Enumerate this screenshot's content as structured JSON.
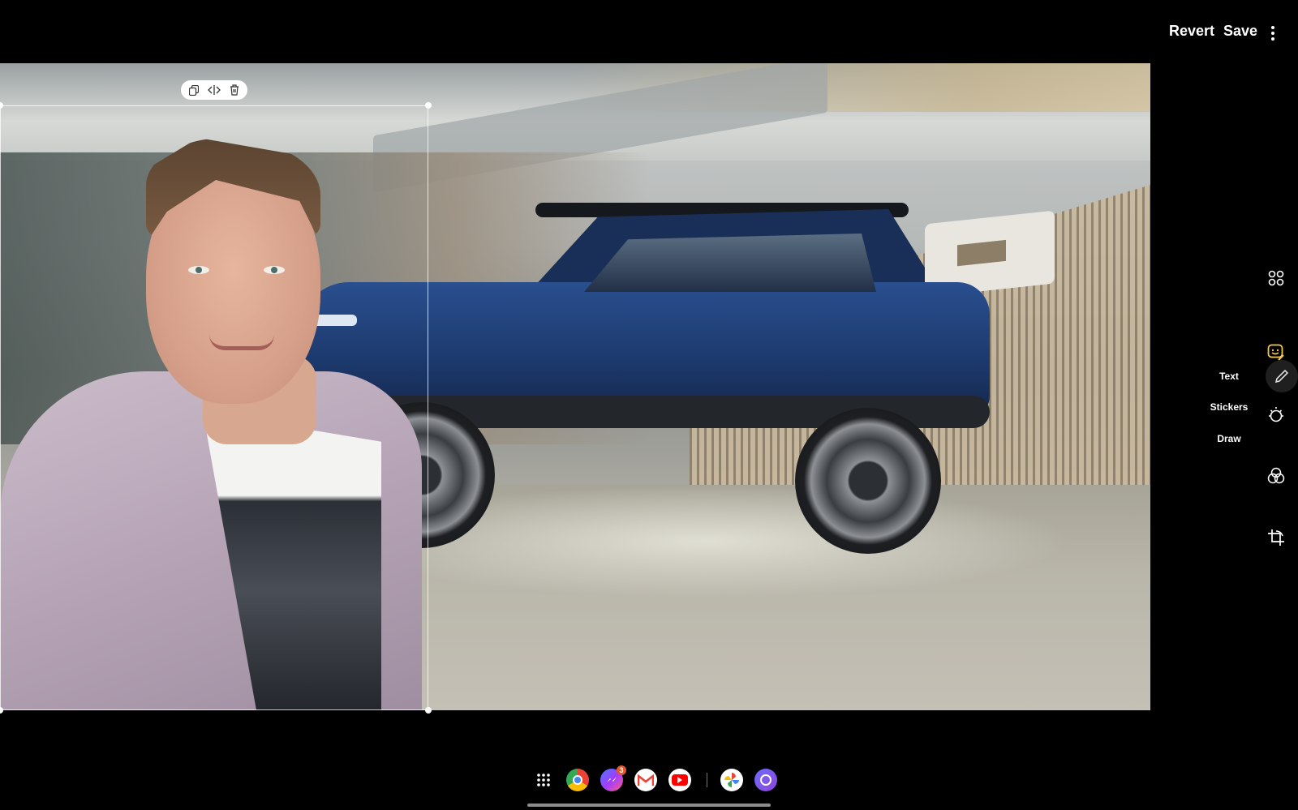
{
  "header": {
    "revert_label": "Revert",
    "save_label": "Save",
    "more_icon": "more-vertical-icon"
  },
  "selection_toolbar": {
    "icons": [
      "duplicate-icon",
      "flip-icon",
      "delete-icon"
    ]
  },
  "side_tools": {
    "icons": [
      "grid-icon",
      "decorate-icon",
      "brightness-icon",
      "filters-icon",
      "crop-rotate-icon"
    ],
    "decorate_menu": [
      "Text",
      "Stickers",
      "Draw"
    ],
    "active_item": "draw-pen-icon"
  },
  "dock": {
    "apps": [
      "app-drawer-icon",
      "chrome-icon",
      "messenger-icon",
      "gmail-icon",
      "youtube-icon",
      "photos-icon",
      "browser-icon"
    ],
    "messenger_badge": "3"
  }
}
